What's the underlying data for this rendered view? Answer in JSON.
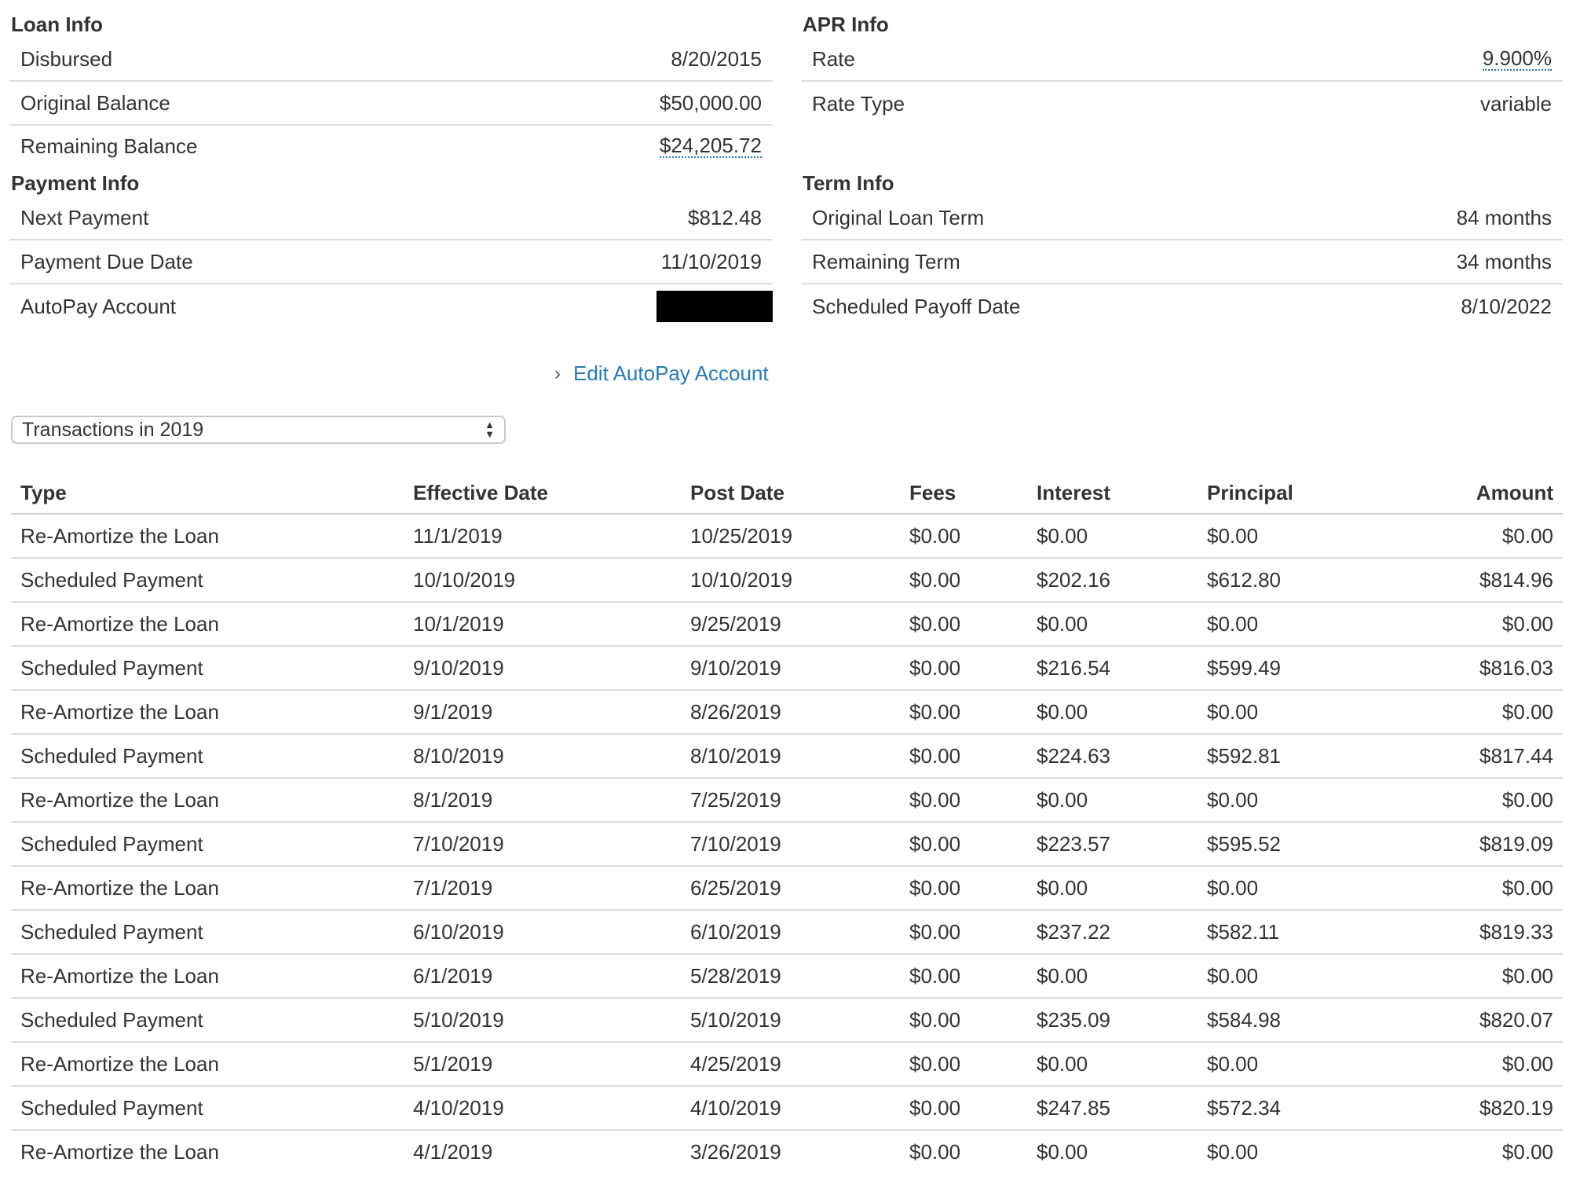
{
  "loan_info": {
    "title": "Loan Info",
    "rows": [
      {
        "label": "Disbursed",
        "value": "8/20/2015"
      },
      {
        "label": "Original Balance",
        "value": "$50,000.00"
      },
      {
        "label": "Remaining Balance",
        "value": "$24,205.72"
      }
    ]
  },
  "apr_info": {
    "title": "APR Info",
    "rows": [
      {
        "label": "Rate",
        "value": "9.900%"
      },
      {
        "label": "Rate Type",
        "value": "variable"
      }
    ]
  },
  "payment_info": {
    "title": "Payment Info",
    "rows": [
      {
        "label": "Next Payment",
        "value": "$812.48"
      },
      {
        "label": "Payment Due Date",
        "value": "11/10/2019"
      },
      {
        "label": "AutoPay Account",
        "value": ""
      }
    ]
  },
  "term_info": {
    "title": "Term Info",
    "rows": [
      {
        "label": "Original Loan Term",
        "value": "84 months"
      },
      {
        "label": "Remaining Term",
        "value": "34 months"
      },
      {
        "label": "Scheduled Payoff Date",
        "value": "8/10/2022"
      }
    ]
  },
  "edit_autopay": {
    "label": "Edit AutoPay Account",
    "icon": "chevron-right-icon"
  },
  "transactions_select": {
    "selected": "Transactions in 2019"
  },
  "table": {
    "headers": [
      "Type",
      "Effective Date",
      "Post Date",
      "Fees",
      "Interest",
      "Principal",
      "Amount"
    ],
    "rows": [
      [
        "Re-Amortize the Loan",
        "11/1/2019",
        "10/25/2019",
        "$0.00",
        "$0.00",
        "$0.00",
        "$0.00"
      ],
      [
        "Scheduled Payment",
        "10/10/2019",
        "10/10/2019",
        "$0.00",
        "$202.16",
        "$612.80",
        "$814.96"
      ],
      [
        "Re-Amortize the Loan",
        "10/1/2019",
        "9/25/2019",
        "$0.00",
        "$0.00",
        "$0.00",
        "$0.00"
      ],
      [
        "Scheduled Payment",
        "9/10/2019",
        "9/10/2019",
        "$0.00",
        "$216.54",
        "$599.49",
        "$816.03"
      ],
      [
        "Re-Amortize the Loan",
        "9/1/2019",
        "8/26/2019",
        "$0.00",
        "$0.00",
        "$0.00",
        "$0.00"
      ],
      [
        "Scheduled Payment",
        "8/10/2019",
        "8/10/2019",
        "$0.00",
        "$224.63",
        "$592.81",
        "$817.44"
      ],
      [
        "Re-Amortize the Loan",
        "8/1/2019",
        "7/25/2019",
        "$0.00",
        "$0.00",
        "$0.00",
        "$0.00"
      ],
      [
        "Scheduled Payment",
        "7/10/2019",
        "7/10/2019",
        "$0.00",
        "$223.57",
        "$595.52",
        "$819.09"
      ],
      [
        "Re-Amortize the Loan",
        "7/1/2019",
        "6/25/2019",
        "$0.00",
        "$0.00",
        "$0.00",
        "$0.00"
      ],
      [
        "Scheduled Payment",
        "6/10/2019",
        "6/10/2019",
        "$0.00",
        "$237.22",
        "$582.11",
        "$819.33"
      ],
      [
        "Re-Amortize the Loan",
        "6/1/2019",
        "5/28/2019",
        "$0.00",
        "$0.00",
        "$0.00",
        "$0.00"
      ],
      [
        "Scheduled Payment",
        "5/10/2019",
        "5/10/2019",
        "$0.00",
        "$235.09",
        "$584.98",
        "$820.07"
      ],
      [
        "Re-Amortize the Loan",
        "5/1/2019",
        "4/25/2019",
        "$0.00",
        "$0.00",
        "$0.00",
        "$0.00"
      ],
      [
        "Scheduled Payment",
        "4/10/2019",
        "4/10/2019",
        "$0.00",
        "$247.85",
        "$572.34",
        "$820.19"
      ],
      [
        "Re-Amortize the Loan",
        "4/1/2019",
        "3/26/2019",
        "$0.00",
        "$0.00",
        "$0.00",
        "$0.00"
      ]
    ]
  }
}
